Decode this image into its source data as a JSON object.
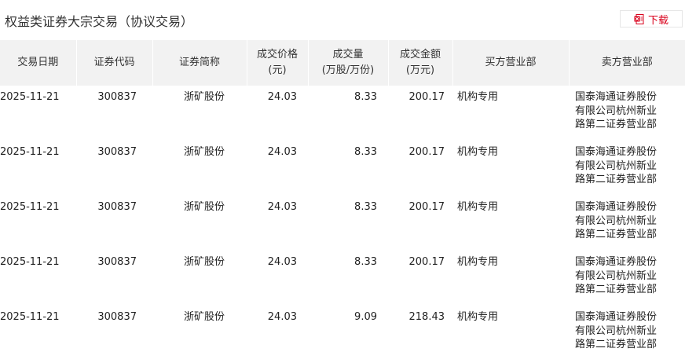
{
  "page": {
    "title": "权益类证券大宗交易（协议交易）",
    "download_label": "下载"
  },
  "colors": {
    "accent": "#d9001b",
    "header_bg": "#f2f2f2"
  },
  "icons": {
    "download": "excel-file-icon"
  },
  "table": {
    "headers": [
      {
        "line1": "交易日期",
        "line2": ""
      },
      {
        "line1": "证券代码",
        "line2": ""
      },
      {
        "line1": "证券简称",
        "line2": ""
      },
      {
        "line1": "成交价格",
        "line2": "(元)"
      },
      {
        "line1": "成交量",
        "line2": "(万股/万份)"
      },
      {
        "line1": "成交金额",
        "line2": "(万元)"
      },
      {
        "line1": "买方营业部",
        "line2": ""
      },
      {
        "line1": "卖方营业部",
        "line2": ""
      }
    ],
    "rows": [
      {
        "date": "2025-11-21",
        "code": "300837",
        "name": "浙矿股份",
        "price": "24.03",
        "volume": "8.33",
        "amount": "200.17",
        "buyer": "机构专用",
        "seller": "国泰海通证券股份有限公司杭州新业路第二证券营业部"
      },
      {
        "date": "2025-11-21",
        "code": "300837",
        "name": "浙矿股份",
        "price": "24.03",
        "volume": "8.33",
        "amount": "200.17",
        "buyer": "机构专用",
        "seller": "国泰海通证券股份有限公司杭州新业路第二证券营业部"
      },
      {
        "date": "2025-11-21",
        "code": "300837",
        "name": "浙矿股份",
        "price": "24.03",
        "volume": "8.33",
        "amount": "200.17",
        "buyer": "机构专用",
        "seller": "国泰海通证券股份有限公司杭州新业路第二证券营业部"
      },
      {
        "date": "2025-11-21",
        "code": "300837",
        "name": "浙矿股份",
        "price": "24.03",
        "volume": "8.33",
        "amount": "200.17",
        "buyer": "机构专用",
        "seller": "国泰海通证券股份有限公司杭州新业路第二证券营业部"
      },
      {
        "date": "2025-11-21",
        "code": "300837",
        "name": "浙矿股份",
        "price": "24.03",
        "volume": "9.09",
        "amount": "218.43",
        "buyer": "机构专用",
        "seller": "国泰海通证券股份有限公司杭州新业路第二证券营业部"
      }
    ]
  }
}
